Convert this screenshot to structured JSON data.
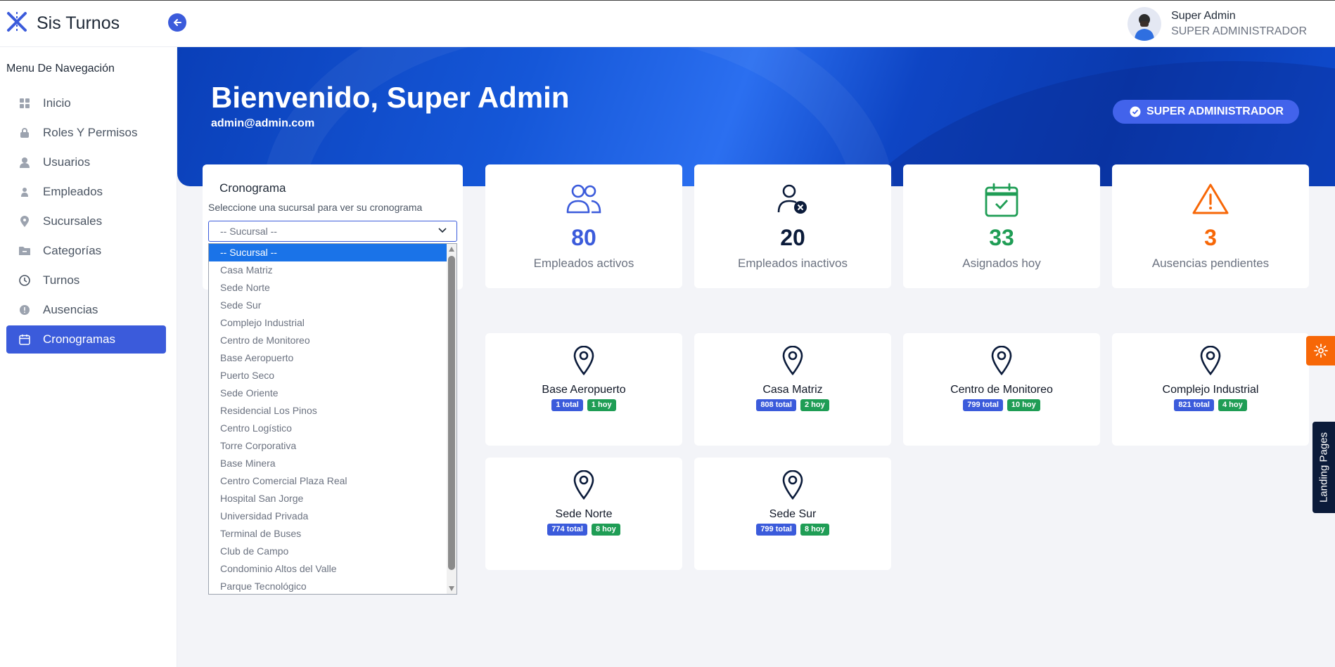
{
  "app": {
    "name": "Sis Turnos"
  },
  "user": {
    "name": "Super Admin",
    "role": "SUPER ADMINISTRADOR"
  },
  "sidebar": {
    "title": "Menu De Navegación",
    "items": [
      {
        "label": "Inicio",
        "icon": "grid-icon"
      },
      {
        "label": "Roles Y Permisos",
        "icon": "lock-icon"
      },
      {
        "label": "Usuarios",
        "icon": "user-icon"
      },
      {
        "label": "Empleados",
        "icon": "person-icon"
      },
      {
        "label": "Sucursales",
        "icon": "location-icon"
      },
      {
        "label": "Categorías",
        "icon": "folder-icon"
      },
      {
        "label": "Turnos",
        "icon": "clock-icon"
      },
      {
        "label": "Ausencias",
        "icon": "alert-circle-icon"
      },
      {
        "label": "Cronogramas",
        "icon": "calendar-icon",
        "active": true
      }
    ]
  },
  "hero": {
    "title": "Bienvenido, Super Admin",
    "email": "admin@admin.com",
    "badge": "SUPER ADMINISTRADOR"
  },
  "schedule": {
    "title": "Cronograma",
    "subtitle": "Seleccione una sucursal para ver su cronograma",
    "select_value": "-- Sucursal --",
    "options": [
      "-- Sucursal --",
      "Casa Matriz",
      "Sede Norte",
      "Sede Sur",
      "Complejo Industrial",
      "Centro de Monitoreo",
      "Base Aeropuerto",
      "Puerto Seco",
      "Sede Oriente",
      "Residencial Los Pinos",
      "Centro Logístico",
      "Torre Corporativa",
      "Base Minera",
      "Centro Comercial Plaza Real",
      "Hospital San Jorge",
      "Universidad Privada",
      "Terminal de Buses",
      "Club de Campo",
      "Condominio Altos del Valle",
      "Parque Tecnológico"
    ]
  },
  "stats": [
    {
      "value": "80",
      "label": "Empleados activos",
      "color": "#3b5bdb",
      "icon": "users-icon"
    },
    {
      "value": "20",
      "label": "Empleados inactivos",
      "color": "#0b1b3a",
      "icon": "user-x-icon"
    },
    {
      "value": "33",
      "label": "Asignados hoy",
      "color": "#1f9d55",
      "icon": "calendar-check-icon"
    },
    {
      "value": "3",
      "label": "Ausencias pendientes",
      "color": "#f76707",
      "icon": "warning-icon"
    }
  ],
  "branches": [
    {
      "name": "Base Aeropuerto",
      "total": "1 total",
      "today": "1 hoy"
    },
    {
      "name": "Casa Matriz",
      "total": "808 total",
      "today": "2 hoy"
    },
    {
      "name": "Centro de Monitoreo",
      "total": "799 total",
      "today": "10 hoy"
    },
    {
      "name": "Complejo Industrial",
      "total": "821 total",
      "today": "4 hoy"
    },
    {
      "name": "Sede Norte",
      "total": "774 total",
      "today": "8 hoy"
    },
    {
      "name": "Sede Sur",
      "total": "799 total",
      "today": "8 hoy"
    }
  ],
  "side_tabs": {
    "landing": "Landing Pages"
  }
}
